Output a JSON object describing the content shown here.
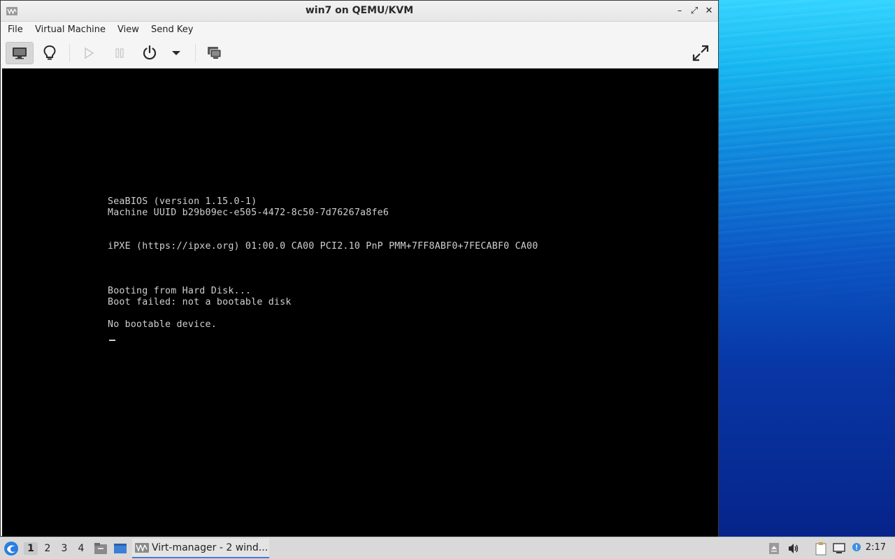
{
  "window": {
    "title": "win7 on QEMU/KVM",
    "controls": {
      "minimize": "–",
      "maximize": "⤢",
      "close": "✕"
    }
  },
  "menu": {
    "items": [
      "File",
      "Virtual Machine",
      "View",
      "Send Key"
    ]
  },
  "toolbar": {
    "buttons": [
      "monitor-icon",
      "lightbulb-icon",
      "play-icon",
      "pause-icon",
      "power-icon",
      "dropdown-arrow-icon",
      "snapshots-icon",
      "fullscreen-icon"
    ]
  },
  "console": {
    "lines": [
      "SeaBIOS (version 1.15.0-1)",
      "Machine UUID b29b09ec-e505-4472-8c50-7d76267a8fe6",
      "iPXE (https://ipxe.org) 01:00.0 CA00 PCI2.10 PnP PMM+7FF8ABF0+7FECABF0 CA00",
      "Booting from Hard Disk...",
      "Boot failed: not a bootable disk",
      "No bootable device."
    ]
  },
  "taskbar": {
    "workspaces": [
      "1",
      "2",
      "3",
      "4"
    ],
    "active_workspace": "1",
    "task_label": "Virt-manager - 2 wind...",
    "clock": "2:17"
  },
  "colors": {
    "console_bg": "#000000",
    "console_fg": "#cfcfcf",
    "task_accent": "#3d7fd6"
  }
}
